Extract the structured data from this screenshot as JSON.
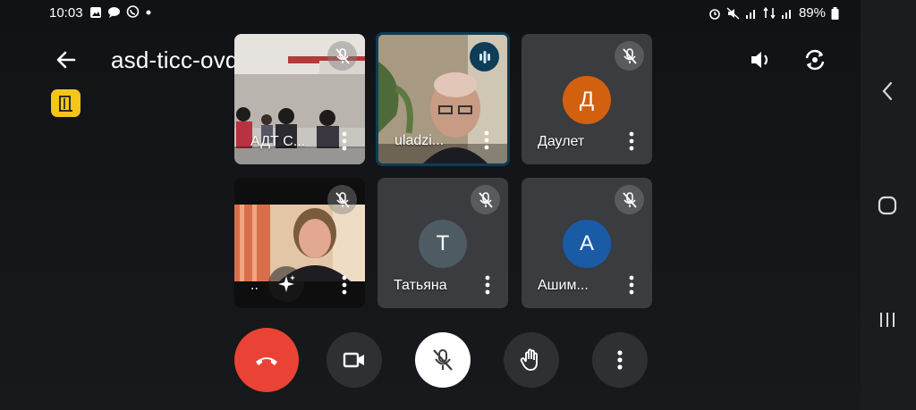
{
  "status_bar": {
    "time": "10:03",
    "battery_percent": "89%",
    "left_icons": [
      "image-icon",
      "chat-icon",
      "viber-icon",
      "dot-icon"
    ],
    "right_icons": [
      "alarm-icon",
      "mute-icon",
      "signal-icon",
      "signal-icon",
      "signal-icon",
      "battery-icon"
    ]
  },
  "header": {
    "title": "asd-ticc-ovd",
    "leave_badge_color": "#f5c61a"
  },
  "participants": [
    {
      "name": "АДТ С...",
      "type": "video",
      "muted": true
    },
    {
      "name": "uladzi...",
      "type": "video",
      "speaking": true
    },
    {
      "name": "Даулет",
      "type": "avatar",
      "initial": "Д",
      "avatar_color": "#d2600e",
      "muted": true
    },
    {
      "name": "..",
      "type": "video",
      "muted": true,
      "effects": true
    },
    {
      "name": "Татьяна",
      "type": "avatar",
      "initial": "Т",
      "avatar_color": "#4f5b62",
      "muted": true
    },
    {
      "name": "Ашим...",
      "type": "avatar",
      "initial": "А",
      "avatar_color": "#1a5ba6",
      "muted": true
    }
  ],
  "controls": {
    "hangup_color": "#ea4335",
    "items": [
      "hangup-button",
      "camera-button",
      "microphone-button",
      "raise-hand-button",
      "more-options-button"
    ]
  },
  "colors": {
    "active_border": "#0d3d57",
    "tile_bg": "#3a3c40"
  }
}
